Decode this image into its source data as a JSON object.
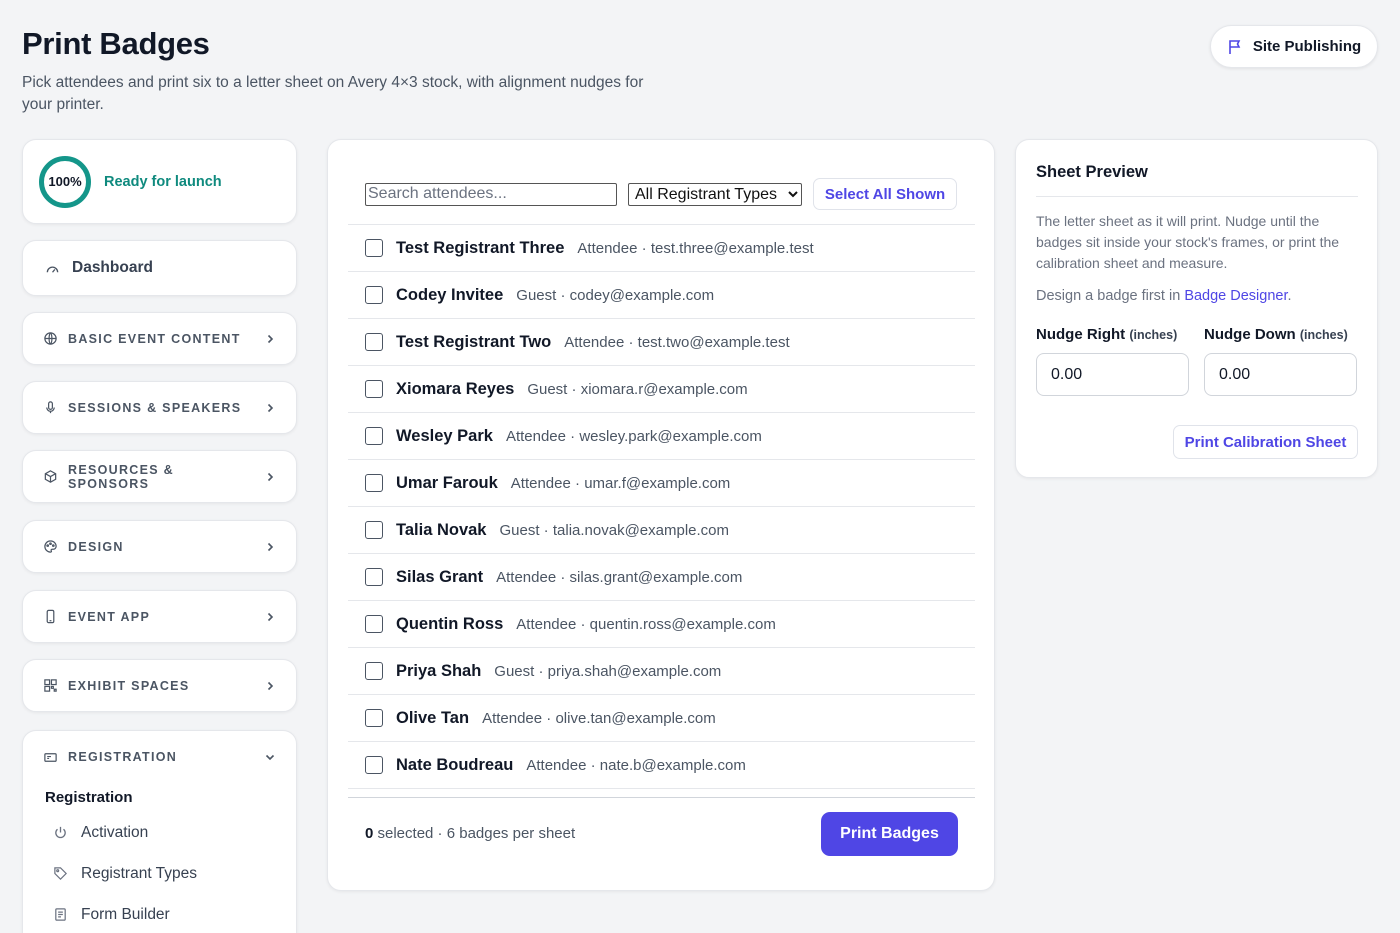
{
  "header": {
    "title": "Print Badges",
    "subtitle": "Pick attendees and print six to a letter sheet on Avery 4×3 stock, with alignment nudges for your printer.",
    "publish_label": "Site Publishing",
    "publish_icon": "flag-icon"
  },
  "sidebar": {
    "launch": {
      "percent": "100%",
      "progress": 1.0,
      "status": "Ready for launch",
      "color": "#14968a"
    },
    "dashboard": {
      "label": "Dashboard",
      "icon": "gauge-icon"
    },
    "sections": [
      {
        "label": "BASIC EVENT CONTENT",
        "icon": "globe-icon"
      },
      {
        "label": "SESSIONS & SPEAKERS",
        "icon": "microphone-icon"
      },
      {
        "label": "RESOURCES & SPONSORS",
        "icon": "box-icon"
      },
      {
        "label": "DESIGN",
        "icon": "palette-icon"
      },
      {
        "label": "EVENT APP",
        "icon": "phone-icon"
      },
      {
        "label": "EXHIBIT SPACES",
        "icon": "grid-icon"
      }
    ],
    "registration": {
      "label": "REGISTRATION",
      "icon": "ticket-icon",
      "expanded": true,
      "sub_title": "Registration",
      "items": [
        {
          "label": "Activation",
          "icon": "power-icon"
        },
        {
          "label": "Registrant Types",
          "icon": "tag-icon"
        },
        {
          "label": "Form Builder",
          "icon": "form-icon"
        }
      ]
    }
  },
  "main": {
    "search_placeholder": "Search attendees...",
    "search_value": "",
    "type_filter": "All Registrant Types",
    "select_all_label": "Select All Shown",
    "attendees": [
      {
        "name": "Test Registrant Three",
        "type": "Attendee",
        "email": "test.three@example.test",
        "checked": false
      },
      {
        "name": "Codey Invitee",
        "type": "Guest",
        "email": "codey@example.com",
        "checked": false
      },
      {
        "name": "Test Registrant Two",
        "type": "Attendee",
        "email": "test.two@example.test",
        "checked": false
      },
      {
        "name": "Xiomara Reyes",
        "type": "Guest",
        "email": "xiomara.r@example.com",
        "checked": false
      },
      {
        "name": "Wesley Park",
        "type": "Attendee",
        "email": "wesley.park@example.com",
        "checked": false
      },
      {
        "name": "Umar Farouk",
        "type": "Attendee",
        "email": "umar.f@example.com",
        "checked": false
      },
      {
        "name": "Talia Novak",
        "type": "Guest",
        "email": "talia.novak@example.com",
        "checked": false
      },
      {
        "name": "Silas Grant",
        "type": "Attendee",
        "email": "silas.grant@example.com",
        "checked": false
      },
      {
        "name": "Quentin Ross",
        "type": "Attendee",
        "email": "quentin.ross@example.com",
        "checked": false
      },
      {
        "name": "Priya Shah",
        "type": "Guest",
        "email": "priya.shah@example.com",
        "checked": false
      },
      {
        "name": "Olive Tan",
        "type": "Attendee",
        "email": "olive.tan@example.com",
        "checked": false
      },
      {
        "name": "Nate Boudreau",
        "type": "Attendee",
        "email": "nate.b@example.com",
        "checked": false
      }
    ],
    "meta_separator": " · ",
    "selected_count": "0",
    "selected_suffix": " selected · 6 badges per sheet",
    "print_label": "Print Badges",
    "accent": "#4f46e5"
  },
  "preview": {
    "title": "Sheet Preview",
    "description": "The letter sheet as it will print. Nudge until the badges sit inside your stock's frames, or print the calibration sheet and measure.",
    "note_prefix": "Design a badge first in ",
    "note_link": "Badge Designer",
    "note_suffix": ".",
    "nudge_right_label": "Nudge Right",
    "nudge_right_unit": "(inches)",
    "nudge_right_value": "0.00",
    "nudge_down_label": "Nudge Down",
    "nudge_down_unit": "(inches)",
    "nudge_down_value": "0.00",
    "calibration_label": "Print Calibration Sheet"
  }
}
